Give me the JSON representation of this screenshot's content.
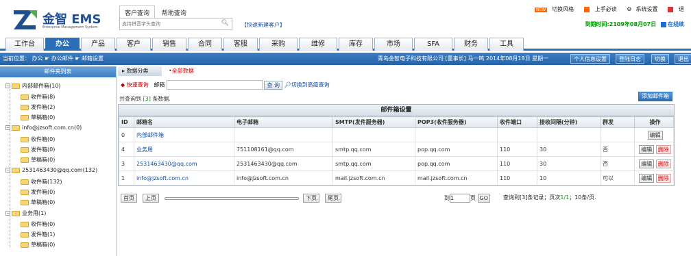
{
  "logo": {
    "text": "金智 EMS",
    "sub": "Enterprise Management System"
  },
  "search": {
    "tabs": [
      "客户查询",
      "帮助查询"
    ],
    "placeholder": "支持拼音字头查询",
    "quick_new": "【快速新建客户】"
  },
  "toplinks": {
    "new_badge": "NEW",
    "style": "切换风格",
    "guide": "上手必读",
    "settings": "系统设置",
    "close": "退"
  },
  "expire": {
    "text": "到期时间:2109年08月07日",
    "online": "在线续"
  },
  "nav": {
    "tabs": [
      "工作台",
      "办公",
      "产品",
      "客户",
      "销售",
      "合同",
      "客服",
      "采购",
      "维修",
      "库存",
      "市场",
      "SFA",
      "财务",
      "工具"
    ],
    "active": "办公"
  },
  "crumb": {
    "text": "当前位置：  办公  ☛  办公邮件  ☛  邮箱设置"
  },
  "header": {
    "company": "青岛金智电子科技有限公司 [董事长] 马一鸣   2014年08月18日   星期一",
    "buttons": [
      "个人信息设置",
      "登陆日志",
      "切换",
      "退出"
    ]
  },
  "sidebar": {
    "title": "邮件夹列表",
    "groups": [
      {
        "label": "内部邮件箱(10)",
        "children": [
          "收件箱(8)",
          "发件箱(2)",
          "草稿箱(0)"
        ]
      },
      {
        "label": "info@jzsoft.com.cn(0)",
        "children": [
          "收件箱(0)",
          "发件箱(0)",
          "草稿箱(0)"
        ]
      },
      {
        "label": "2531463430@qq.com(132)",
        "children": [
          "收件箱(132)",
          "发件箱(0)",
          "草稿箱(0)"
        ]
      },
      {
        "label": "业务用(1)",
        "children": [
          "收件箱(0)",
          "发件箱(1)",
          "草稿箱(0)"
        ]
      }
    ]
  },
  "main": {
    "subtabs": [
      "数据分类",
      "•全部数据"
    ],
    "quick_search": "快速查询",
    "mailbox_label": "邮箱",
    "query_btn": "查 询",
    "advanced": "切换到高级查询",
    "found_prefix": "共查询到 ",
    "found_count": "[3]",
    "found_suffix": " 条数据.",
    "add_button": "添加邮件箱",
    "table_title": "邮件箱设置",
    "columns": [
      "ID",
      "邮箱名",
      "电子邮箱",
      "SMTP(发件服务器)",
      "POP3(收件服务器)",
      "收件端口",
      "接收间隔(分钟)",
      "群发",
      "操作"
    ],
    "rows": [
      {
        "id": "0",
        "name": "内部邮件箱",
        "email": "",
        "smtp": "",
        "pop3": "",
        "port": "",
        "interval": "",
        "mass": "",
        "edit": "编辑",
        "del": ""
      },
      {
        "id": "4",
        "name": "业务用",
        "email": "751108161@qq.com",
        "smtp": "smtp.qq.com",
        "pop3": "pop.qq.com",
        "port": "110",
        "interval": "30",
        "mass": "否",
        "edit": "编辑",
        "del": "删除"
      },
      {
        "id": "3",
        "name": "2531463430@qq.com",
        "email": "2531463430@qq.com",
        "smtp": "smtp.qq.com",
        "pop3": "pop.qq.com",
        "port": "110",
        "interval": "30",
        "mass": "否",
        "edit": "编辑",
        "del": "删除"
      },
      {
        "id": "1",
        "name": "info@jzsoft.com.cn",
        "email": "info@jzsoft.com.cn",
        "smtp": "mail.jzsoft.com.cn",
        "pop3": "mail.jzsoft.com.cn",
        "port": "110",
        "interval": "10",
        "mass": "可以",
        "edit": "编辑",
        "del": "删除"
      }
    ],
    "pager": {
      "first": "首页",
      "prev": "上页",
      "next": "下页",
      "last": "尾页",
      "goto_prefix": "到",
      "page_value": "1",
      "goto_suffix": "页",
      "go": "GO",
      "info_prefix": "查询到[3]条记录；页次",
      "info_page": "1/1",
      "info_suffix": "；10条/页."
    }
  }
}
